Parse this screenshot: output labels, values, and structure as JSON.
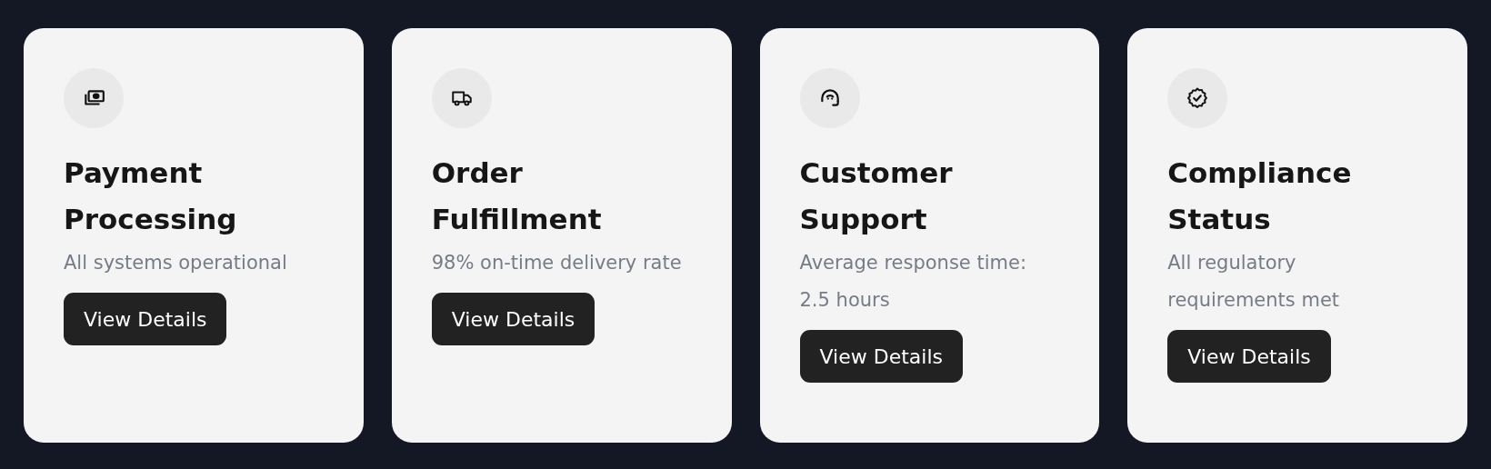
{
  "cards": [
    {
      "title": "Payment Processing",
      "description": "All systems operational",
      "button": "View Details"
    },
    {
      "title": "Order Fulfillment",
      "description": "98% on-time delivery rate",
      "button": "View Details"
    },
    {
      "title": "Customer Support",
      "description": "Average response time: 2.5 hours",
      "button": "View Details"
    },
    {
      "title": "Compliance Status",
      "description": "All regulatory requirements met",
      "button": "View Details"
    }
  ]
}
